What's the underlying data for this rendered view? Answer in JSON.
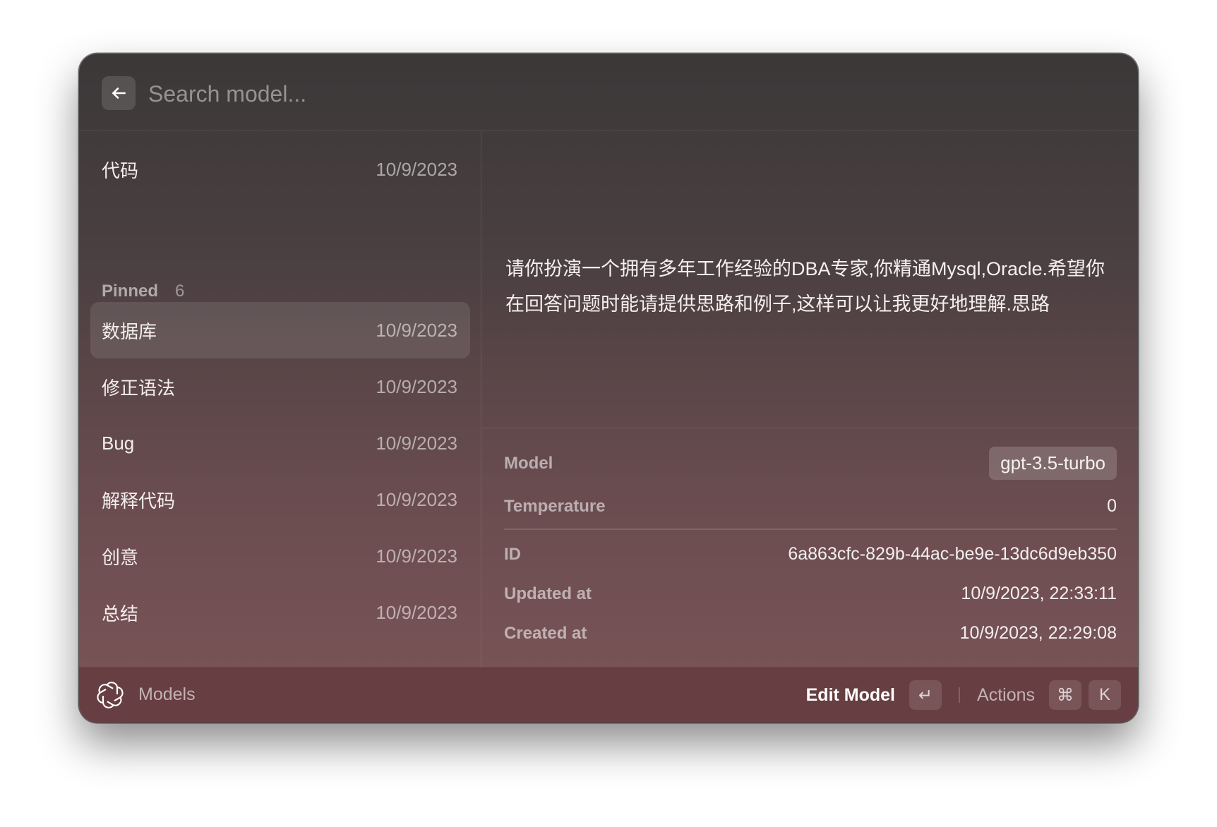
{
  "search": {
    "placeholder": "Search model..."
  },
  "list": {
    "top_item": {
      "title": "代码",
      "date": "10/9/2023"
    },
    "section": {
      "title": "Pinned",
      "count": "6"
    },
    "items": [
      {
        "title": "数据库",
        "date": "10/9/2023",
        "selected": true
      },
      {
        "title": "修正语法",
        "date": "10/9/2023"
      },
      {
        "title": "Bug",
        "date": "10/9/2023"
      },
      {
        "title": "解释代码",
        "date": "10/9/2023"
      },
      {
        "title": "创意",
        "date": "10/9/2023"
      },
      {
        "title": "总结",
        "date": "10/9/2023"
      }
    ]
  },
  "detail": {
    "prompt": "请你扮演一个拥有多年工作经验的DBA专家,你精通Mysql,Oracle.希望你在回答问题时能请提供思路和例子,这样可以让我更好地理解.思路",
    "meta": {
      "model_label": "Model",
      "model_value": "gpt-3.5-turbo",
      "temperature_label": "Temperature",
      "temperature_value": "0",
      "id_label": "ID",
      "id_value": "6a863cfc-829b-44ac-be9e-13dc6d9eb350",
      "updated_label": "Updated at",
      "updated_value": "10/9/2023, 22:33:11",
      "created_label": "Created at",
      "created_value": "10/9/2023, 22:29:08"
    }
  },
  "footer": {
    "app_label": "Models",
    "primary_action": "Edit Model",
    "primary_shortcut": "↵",
    "actions_label": "Actions",
    "actions_key1": "⌘",
    "actions_key2": "K"
  },
  "icons": {
    "back": "arrow-left-icon",
    "app": "openai-logo-icon"
  },
  "colors": {
    "footer_bg": "#673e41",
    "selected_row": "rgba(255,255,255,0.10)"
  }
}
